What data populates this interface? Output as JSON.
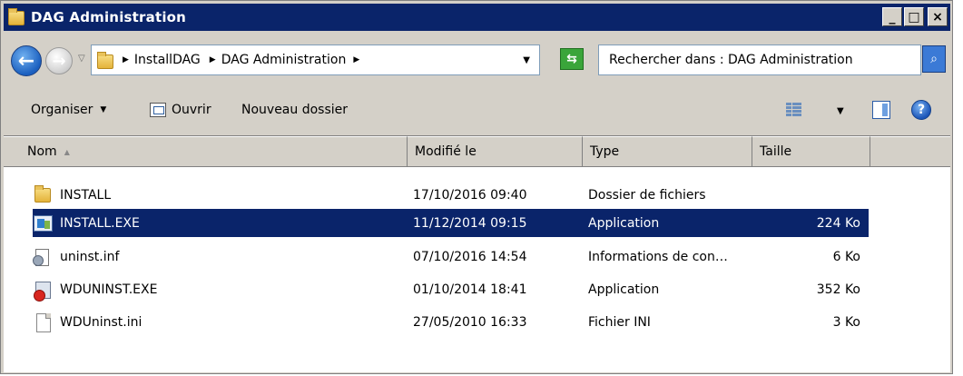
{
  "window": {
    "title": "DAG Administration",
    "minimize": "_",
    "maximize": "□",
    "close": "×"
  },
  "address": {
    "breadcrumbs": [
      "InstallDAG",
      "DAG Administration"
    ],
    "search_placeholder": "Rechercher dans : DAG Administration"
  },
  "commands": {
    "organize": "Organiser",
    "open": "Ouvrir",
    "new_folder": "Nouveau dossier",
    "help": "?"
  },
  "columns": {
    "name": "Nom",
    "modified": "Modifié le",
    "type": "Type",
    "size": "Taille"
  },
  "files": [
    {
      "name": "INSTALL",
      "modified": "17/10/2016 09:40",
      "type": "Dossier de fichiers",
      "size": "",
      "icon": "folder-icon",
      "selected": false
    },
    {
      "name": "INSTALL.EXE",
      "modified": "11/12/2014 09:15",
      "type": "Application",
      "size": "224 Ko",
      "icon": "application-icon",
      "selected": true
    },
    {
      "name": "uninst.inf",
      "modified": "07/10/2016 14:54",
      "type": "Informations de con…",
      "size": "6 Ko",
      "icon": "config-file-icon",
      "selected": false
    },
    {
      "name": "WDUNINST.EXE",
      "modified": "01/10/2014 18:41",
      "type": "Application",
      "size": "352 Ko",
      "icon": "uninstall-icon",
      "selected": false
    },
    {
      "name": "WDUninst.ini",
      "modified": "27/05/2010 16:33",
      "type": "Fichier INI",
      "size": "3 Ko",
      "icon": "ini-file-icon",
      "selected": false
    }
  ],
  "colors": {
    "titlebar": "#0a246a",
    "selection": "#0a246a",
    "chrome": "#d4d0c8"
  }
}
